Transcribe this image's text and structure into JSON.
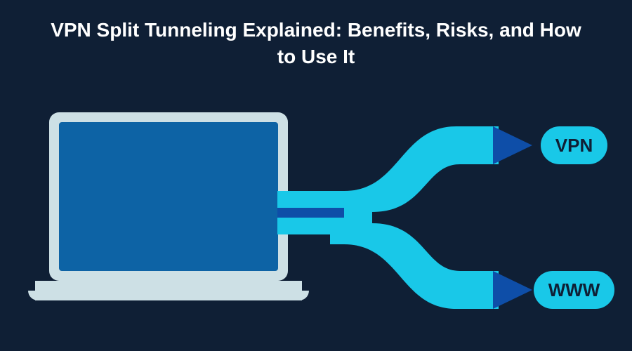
{
  "title": "VPN Split Tunneling Explained: Benefits, Risks, and How to Use It",
  "labels": {
    "vpn": "VPN",
    "www": "WWW"
  },
  "colors": {
    "background": "#0f1f35",
    "tunnel": "#19c8e8",
    "tunnel_inner": "#0e4ea8",
    "arrow": "#0e4ea8",
    "laptop_shell": "#cde0e5",
    "laptop_screen": "#0d63a5",
    "text": "#ffffff"
  }
}
